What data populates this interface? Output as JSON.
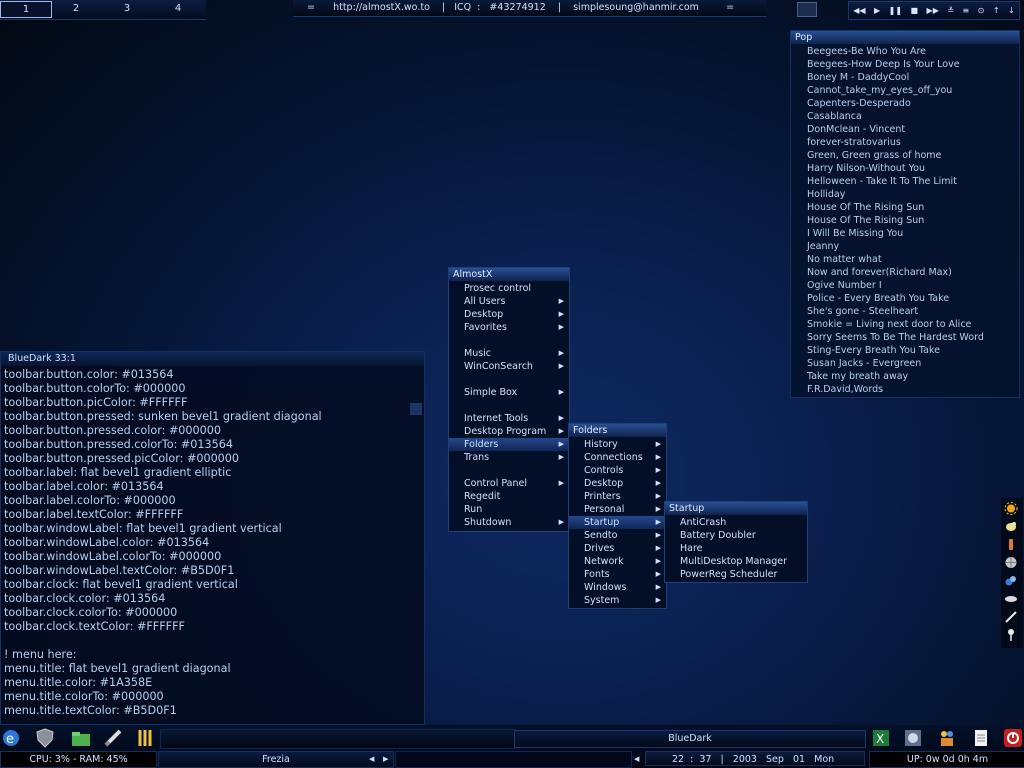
{
  "desktops": [
    "1",
    "2",
    "3",
    "4"
  ],
  "top_info": "=      http://almostX.wo.to    |   ICQ  :   #43274912    |    simplesoung@hanmir.com         =",
  "player_controls": [
    "◀◀",
    "▶",
    "❚❚",
    "■",
    "▶▶",
    "≚",
    "≡",
    "⊙",
    "↑",
    "↓"
  ],
  "pop": {
    "title": "Pop",
    "items": [
      "Beegees-Be Who You Are",
      "Beegees-How Deep Is Your Love",
      "Boney M - DaddyCool",
      "Cannot_take_my_eyes_off_you",
      "Capenters-Desperado",
      "Casablanca",
      "DonMclean - Vincent",
      "forever-stratovarius",
      "Green, Green grass of home",
      "Harry Nilson-Without You",
      "Helloween - Take It To The Limit",
      "Holliday",
      "House Of The Rising Sun",
      "House Of The Rising Sun",
      "I Will Be Missing You",
      "Jeanny",
      "No matter what",
      "Now and forever(Richard Max)",
      "Ogive Number I",
      "Police - Every Breath You Take",
      "She's gone - Steelheart",
      "Smokie = Living next door to Alice",
      "Sorry Seems To Be The Hardest Word",
      "Sting-Every Breath You Take",
      "Susan Jacks - Evergreen",
      "Take my breath away",
      "F.R.David,Words"
    ]
  },
  "bluedark": {
    "title": "BlueDark   33:1",
    "lines": [
      "toolbar.button.color: #013564",
      "toolbar.button.colorTo: #000000",
      "toolbar.button.picColor: #FFFFFF",
      "toolbar.button.pressed: sunken bevel1 gradient diagonal",
      "toolbar.button.pressed.color: #000000",
      "toolbar.button.pressed.colorTo: #013564",
      "toolbar.button.pressed.picColor: #000000",
      "toolbar.label: flat bevel1 gradient elliptic",
      "toolbar.label.color: #013564",
      "toolbar.label.colorTo: #000000",
      "toolbar.label.textColor: #FFFFFF",
      "toolbar.windowLabel: flat bevel1 gradient vertical",
      "toolbar.windowLabel.color: #013564",
      "toolbar.windowLabel.colorTo: #000000",
      "toolbar.windowLabel.textColor: #B5D0F1",
      "toolbar.clock: flat bevel1 gradient vertical",
      "toolbar.clock.color: #013564",
      "toolbar.clock.colorTo: #000000",
      "toolbar.clock.textColor: #FFFFFF",
      "",
      "! menu here:",
      "menu.title: flat bevel1 gradient diagonal",
      "menu.title.color: #1A358E",
      "menu.title.colorTo: #000000",
      "menu.title.textColor: #B5D0F1"
    ]
  },
  "menu_main": {
    "title": "AlmostX",
    "items": [
      {
        "label": "Prosec control",
        "sub": false
      },
      {
        "label": "All Users",
        "sub": true
      },
      {
        "label": "Desktop",
        "sub": true
      },
      {
        "label": "Favorites",
        "sub": true
      },
      {
        "label": "",
        "sub": false
      },
      {
        "label": "Music",
        "sub": true
      },
      {
        "label": "WinConSearch",
        "sub": true
      },
      {
        "label": "",
        "sub": false
      },
      {
        "label": "Simple Box",
        "sub": true
      },
      {
        "label": "",
        "sub": false
      },
      {
        "label": "Internet Tools",
        "sub": true
      },
      {
        "label": "Desktop Program",
        "sub": true
      },
      {
        "label": "Folders",
        "sub": true,
        "selected": true
      },
      {
        "label": "Trans",
        "sub": true
      },
      {
        "label": "",
        "sub": false
      },
      {
        "label": "Control Panel",
        "sub": true
      },
      {
        "label": "Regedit",
        "sub": false
      },
      {
        "label": "Run",
        "sub": false
      },
      {
        "label": "Shutdown",
        "sub": true
      }
    ]
  },
  "menu_folders": {
    "title": "Folders",
    "items": [
      {
        "label": "History",
        "sub": true
      },
      {
        "label": "Connections",
        "sub": true
      },
      {
        "label": "Controls",
        "sub": true
      },
      {
        "label": "Desktop",
        "sub": true
      },
      {
        "label": "Printers",
        "sub": true
      },
      {
        "label": "Personal",
        "sub": true
      },
      {
        "label": "Startup",
        "sub": true,
        "selected": true
      },
      {
        "label": "Sendto",
        "sub": true
      },
      {
        "label": "Drives",
        "sub": true
      },
      {
        "label": "Network",
        "sub": true
      },
      {
        "label": "Fonts",
        "sub": true
      },
      {
        "label": "Windows",
        "sub": true
      },
      {
        "label": "System",
        "sub": true
      }
    ]
  },
  "menu_startup": {
    "title": "Startup",
    "items": [
      {
        "label": "AntiCrash",
        "sub": false
      },
      {
        "label": "Battery Doubler",
        "sub": false
      },
      {
        "label": "Hare",
        "sub": false
      },
      {
        "label": "MultiDesktop Manager",
        "sub": false
      },
      {
        "label": "PowerReg Scheduler",
        "sub": false
      }
    ]
  },
  "taskbar": {
    "window_label": "BlueDark",
    "cpu": "CPU: 3% - RAM: 45%",
    "workspace": "Frezia",
    "clock": "22  :  37   |   2003   Sep   01   Mon",
    "uptime": "UP: 0w 0d 0h 4m"
  },
  "colors": {
    "accent": "#1A358E",
    "text": "#B5D0F1"
  }
}
